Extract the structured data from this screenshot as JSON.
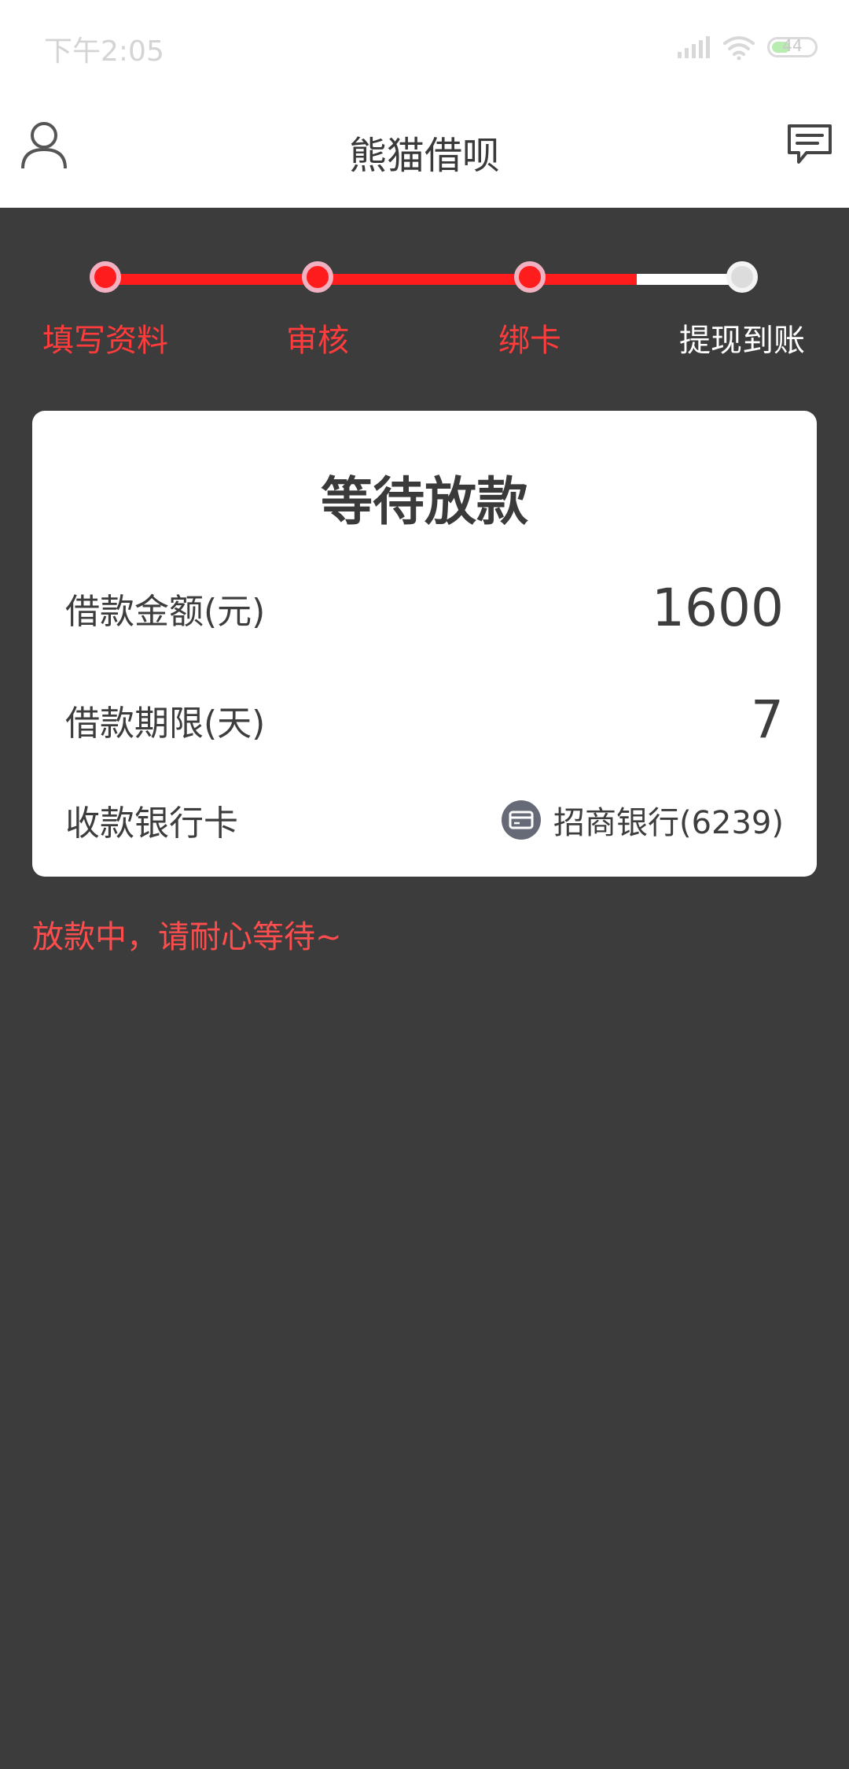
{
  "status_bar": {
    "time": "下午2:05",
    "battery": "44",
    "battery_level": 0.44
  },
  "header": {
    "title": "熊猫借呗"
  },
  "progress": {
    "steps": [
      {
        "label": "填写资料",
        "status": "done"
      },
      {
        "label": "审核",
        "status": "done"
      },
      {
        "label": "绑卡",
        "status": "done"
      },
      {
        "label": "提现到账",
        "status": "pending"
      }
    ]
  },
  "card": {
    "title": "等待放款",
    "amount_label": "借款金额(元)",
    "amount_value": "1600",
    "term_label": "借款期限(天)",
    "term_value": "7",
    "bank_label": "收款银行卡",
    "bank_value": "招商银行(6239)"
  },
  "notice": "放款中，请耐心等待~",
  "colors": {
    "accent": "#ff1c1c",
    "background": "#3c3c3d",
    "step_done_text": "#ff3b3b",
    "step_pending_text": "#ffffff",
    "notice_text": "#ff4d4d"
  }
}
